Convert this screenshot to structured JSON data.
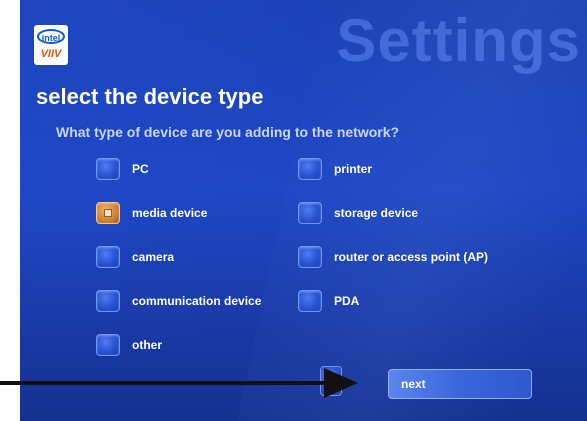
{
  "header": {
    "logo_brand": "intel",
    "logo_sub": "VIIV",
    "watermark": "Settings"
  },
  "page": {
    "heading": "select the device type",
    "question": "What type of device are you adding to the network?"
  },
  "options": [
    {
      "label": "PC",
      "selected": false
    },
    {
      "label": "media device",
      "selected": true
    },
    {
      "label": "camera",
      "selected": false
    },
    {
      "label": "communication device",
      "selected": false
    },
    {
      "label": "other",
      "selected": false
    },
    {
      "label": "printer",
      "selected": false
    },
    {
      "label": "storage device",
      "selected": false
    },
    {
      "label": "router or access point (AP)",
      "selected": false
    },
    {
      "label": "PDA",
      "selected": false
    }
  ],
  "footer": {
    "next_label": "next"
  },
  "colors": {
    "background": "#1d46c2",
    "selected": "#d17f2f",
    "arrow": "#111111"
  }
}
